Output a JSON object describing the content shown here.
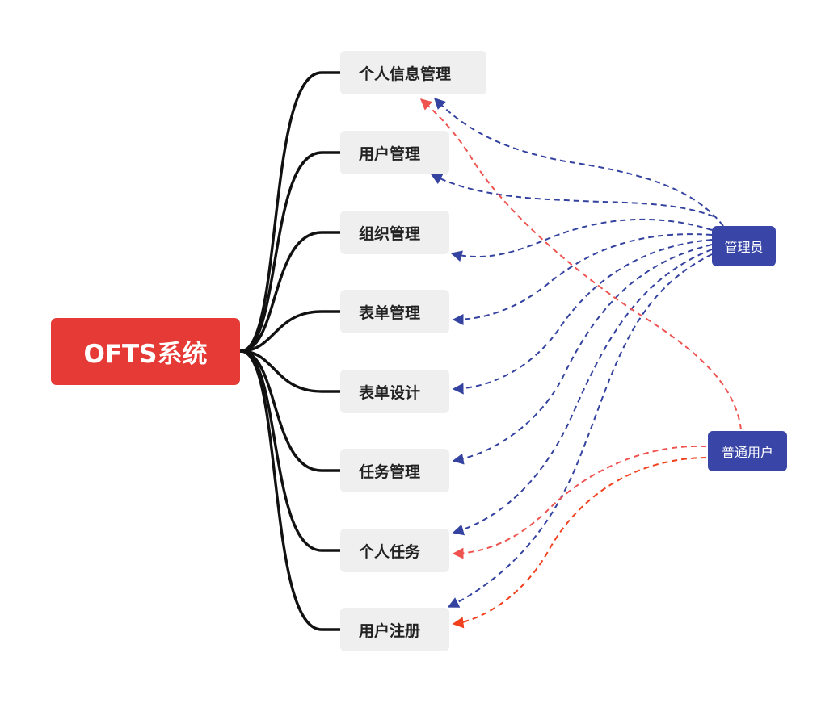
{
  "root": {
    "label": "OFTS系统"
  },
  "features": [
    {
      "key": "personal-info",
      "label": "个人信息管理"
    },
    {
      "key": "user-management",
      "label": "用户管理"
    },
    {
      "key": "org-management",
      "label": "组织管理"
    },
    {
      "key": "form-management",
      "label": "表单管理"
    },
    {
      "key": "form-design",
      "label": "表单设计"
    },
    {
      "key": "task-management",
      "label": "任务管理"
    },
    {
      "key": "personal-tasks",
      "label": "个人任务"
    },
    {
      "key": "user-register",
      "label": "用户注册"
    }
  ],
  "roles": {
    "admin": {
      "label": "管理员"
    },
    "user": {
      "label": "普通用户"
    }
  },
  "colors": {
    "root_fill": "#e53a35",
    "feature_fill": "#efefef",
    "role_fill": "#3946a8",
    "tree_line": "#111111",
    "admin_link": "#3442a0",
    "user_link": "#ef5350",
    "register_link": "#f0401d"
  },
  "links": [
    {
      "from": "admin",
      "to": "personal-info",
      "color": "admin_link"
    },
    {
      "from": "admin",
      "to": "user-management",
      "color": "admin_link"
    },
    {
      "from": "admin",
      "to": "org-management",
      "color": "admin_link"
    },
    {
      "from": "admin",
      "to": "form-management",
      "color": "admin_link"
    },
    {
      "from": "admin",
      "to": "form-design",
      "color": "admin_link"
    },
    {
      "from": "admin",
      "to": "task-management",
      "color": "admin_link"
    },
    {
      "from": "admin",
      "to": "personal-tasks",
      "color": "admin_link"
    },
    {
      "from": "admin",
      "to": "user-register",
      "color": "admin_link"
    },
    {
      "from": "user",
      "to": "personal-info",
      "color": "user_link"
    },
    {
      "from": "user",
      "to": "personal-tasks",
      "color": "user_link"
    },
    {
      "from": "user",
      "to": "user-register",
      "color": "register_link"
    }
  ]
}
